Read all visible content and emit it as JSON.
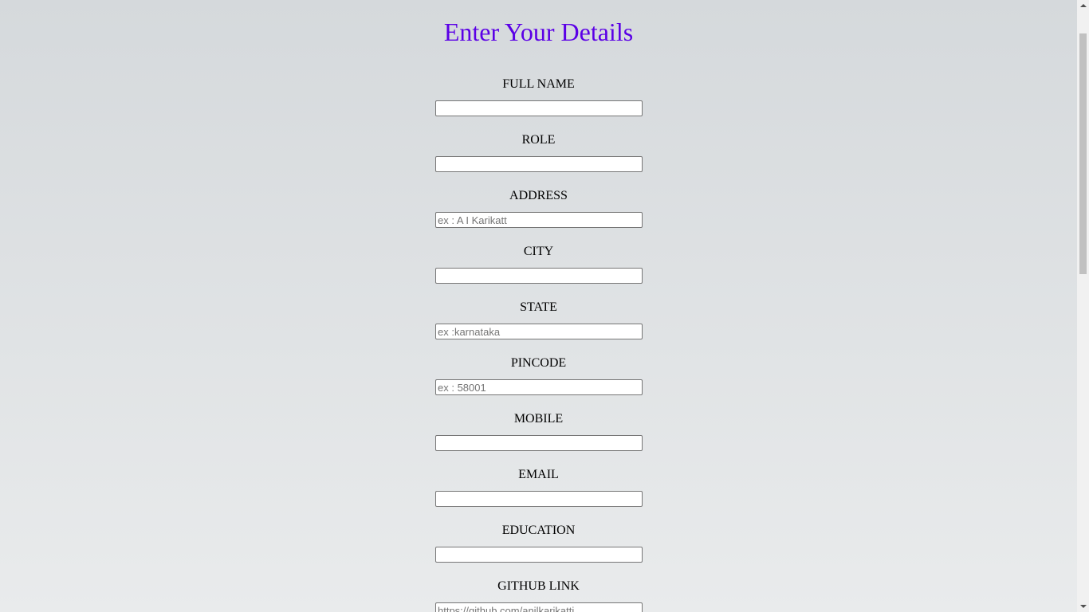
{
  "page": {
    "title": "Enter Your Details",
    "title_color": "#5b00e6"
  },
  "form": {
    "fields": [
      {
        "label": "FULL NAME",
        "value": "",
        "placeholder": ""
      },
      {
        "label": "ROLE",
        "value": "",
        "placeholder": ""
      },
      {
        "label": "ADDRESS",
        "value": "",
        "placeholder": "ex : A I Karikatt"
      },
      {
        "label": "CITY",
        "value": "",
        "placeholder": ""
      },
      {
        "label": "STATE",
        "value": "",
        "placeholder": "ex :karnataka"
      },
      {
        "label": "PINCODE",
        "value": "",
        "placeholder": "ex : 58001"
      },
      {
        "label": "MOBILE",
        "value": "",
        "placeholder": ""
      },
      {
        "label": "EMAIL",
        "value": "",
        "placeholder": ""
      },
      {
        "label": "EDUCATION",
        "value": "",
        "placeholder": ""
      },
      {
        "label": "GITHUB LINK",
        "value": "",
        "placeholder": "https://github.com/anilkarikatti"
      }
    ]
  },
  "scrollbar": {
    "up_icon": "arrow-up-icon",
    "down_icon": "arrow-down-icon"
  }
}
